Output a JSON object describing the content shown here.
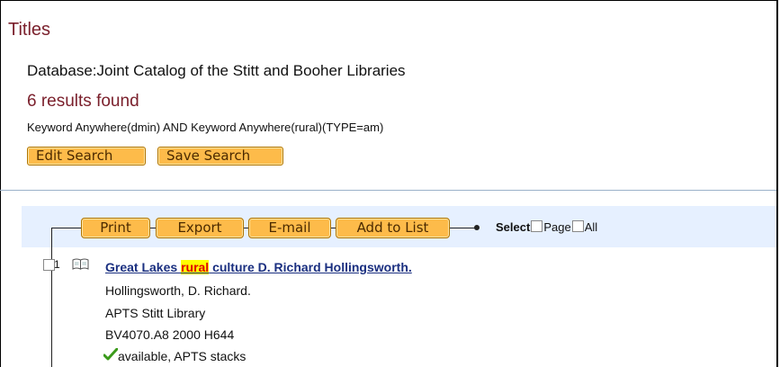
{
  "page": {
    "title": "Titles",
    "database_label": "Database:",
    "database_name": "Joint Catalog of the Stitt and Booher Libraries",
    "results_summary": "6 results found",
    "query": "Keyword Anywhere(dmin) AND Keyword Anywhere(rural)(TYPE=am)"
  },
  "search_actions": {
    "edit_label": "Edit Search",
    "save_label": "Save Search"
  },
  "toolbar": {
    "print_label": "Print",
    "export_label": "Export",
    "email_label": "E-mail",
    "add_label": "Add to List",
    "select_label": "Select",
    "page_label": "Page",
    "all_label": "All"
  },
  "results": [
    {
      "number": "1",
      "title_before": "Great Lakes ",
      "title_highlight": "rural",
      "title_after": " culture D. Richard Hollingsworth.",
      "author": "Hollingsworth, D. Richard.",
      "library": "APTS Stitt Library",
      "call_number": "BV4070.A8 2000 H644",
      "availability": "available, APTS stacks"
    }
  ],
  "colors": {
    "title_maroon": "#7a1f2b",
    "button_orange": "#fdbb4a",
    "toolbar_bg": "#e6f0ff",
    "link_blue": "#1a2f80",
    "highlight": "#ffff00"
  }
}
